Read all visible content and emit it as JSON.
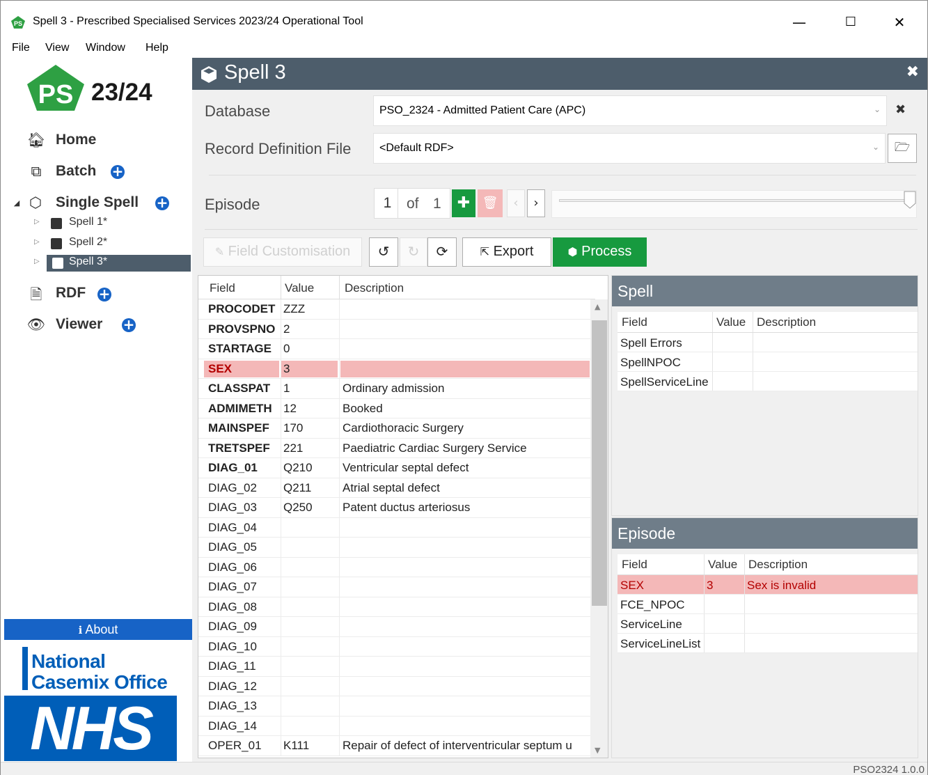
{
  "window": {
    "title": "Spell 3 - Prescribed Specialised Services 2023/24 Operational Tool",
    "minimize": "—",
    "maximize": "☐",
    "close": "✕"
  },
  "menu": [
    "File",
    "View",
    "Window",
    "Help"
  ],
  "sidebar": {
    "logo_ps": "PS",
    "logo_year": "23/24",
    "home": "Home",
    "batch": "Batch",
    "single_spell": "Single Spell",
    "spells": [
      "Spell 1*",
      "Spell 2*",
      "Spell 3*"
    ],
    "rdf": "RDF",
    "viewer": "Viewer",
    "about": "About",
    "nco_line1": "National",
    "nco_line2": "Casemix Office",
    "nhs": "NHS"
  },
  "main": {
    "title": "Spell 3",
    "database_label": "Database",
    "database_value": "PSO_2324 - Admitted Patient Care (APC)",
    "rdf_label": "Record Definition File",
    "rdf_value": "<Default RDF>",
    "episode_label": "Episode",
    "episode_current": "1",
    "episode_of": "of",
    "episode_total": "1",
    "field_customisation": "Field Customisation",
    "export": "Export",
    "process": "Process"
  },
  "field_table": {
    "headers": [
      "Field",
      "Value",
      "Description"
    ],
    "rows": [
      {
        "field": "PROCODET",
        "value": "ZZZ",
        "desc": ""
      },
      {
        "field": "PROVSPNO",
        "value": "2",
        "desc": ""
      },
      {
        "field": "STARTAGE",
        "value": "0",
        "desc": ""
      },
      {
        "field": "SEX",
        "value": "3",
        "desc": ""
      },
      {
        "field": "CLASSPAT",
        "value": "1",
        "desc": "Ordinary admission"
      },
      {
        "field": "ADMIMETH",
        "value": "12",
        "desc": "Booked"
      },
      {
        "field": "MAINSPEF",
        "value": "170",
        "desc": "Cardiothoracic Surgery"
      },
      {
        "field": "TRETSPEF",
        "value": "221",
        "desc": "Paediatric Cardiac Surgery Service"
      },
      {
        "field": "DIAG_01",
        "value": "Q210",
        "desc": "Ventricular septal defect"
      },
      {
        "field": "DIAG_02",
        "value": "Q211",
        "desc": "Atrial septal defect"
      },
      {
        "field": "DIAG_03",
        "value": "Q250",
        "desc": "Patent ductus arteriosus"
      },
      {
        "field": "DIAG_04",
        "value": "",
        "desc": ""
      },
      {
        "field": "DIAG_05",
        "value": "",
        "desc": ""
      },
      {
        "field": "DIAG_06",
        "value": "",
        "desc": ""
      },
      {
        "field": "DIAG_07",
        "value": "",
        "desc": ""
      },
      {
        "field": "DIAG_08",
        "value": "",
        "desc": ""
      },
      {
        "field": "DIAG_09",
        "value": "",
        "desc": ""
      },
      {
        "field": "DIAG_10",
        "value": "",
        "desc": ""
      },
      {
        "field": "DIAG_11",
        "value": "",
        "desc": ""
      },
      {
        "field": "DIAG_12",
        "value": "",
        "desc": ""
      },
      {
        "field": "DIAG_13",
        "value": "",
        "desc": ""
      },
      {
        "field": "DIAG_14",
        "value": "",
        "desc": ""
      },
      {
        "field": "OPER_01",
        "value": "K111",
        "desc": "Repair of defect of interventricular septum u"
      }
    ]
  },
  "spell_panel": {
    "title": "Spell",
    "headers": [
      "Field",
      "Value",
      "Description"
    ],
    "rows": [
      {
        "field": "Spell Errors",
        "value": "",
        "desc": ""
      },
      {
        "field": "SpellNPOC",
        "value": "",
        "desc": ""
      },
      {
        "field": "SpellServiceLine",
        "value": "",
        "desc": ""
      }
    ]
  },
  "episode_panel": {
    "title": "Episode",
    "headers": [
      "Field",
      "Value",
      "Description"
    ],
    "rows": [
      {
        "field": "SEX",
        "value": "3",
        "desc": "Sex is invalid"
      },
      {
        "field": "FCE_NPOC",
        "value": "",
        "desc": ""
      },
      {
        "field": "ServiceLine",
        "value": "",
        "desc": ""
      },
      {
        "field": "ServiceLineList",
        "value": "",
        "desc": ""
      }
    ]
  },
  "status": {
    "version": "PSO2324 1.0.0"
  },
  "colors": {
    "accent_blue": "#1763c6",
    "header_slate": "#4d5d6b",
    "process_green": "#179a3f",
    "error_pink": "#f4b8b8",
    "nhs_blue": "#005eb8"
  }
}
